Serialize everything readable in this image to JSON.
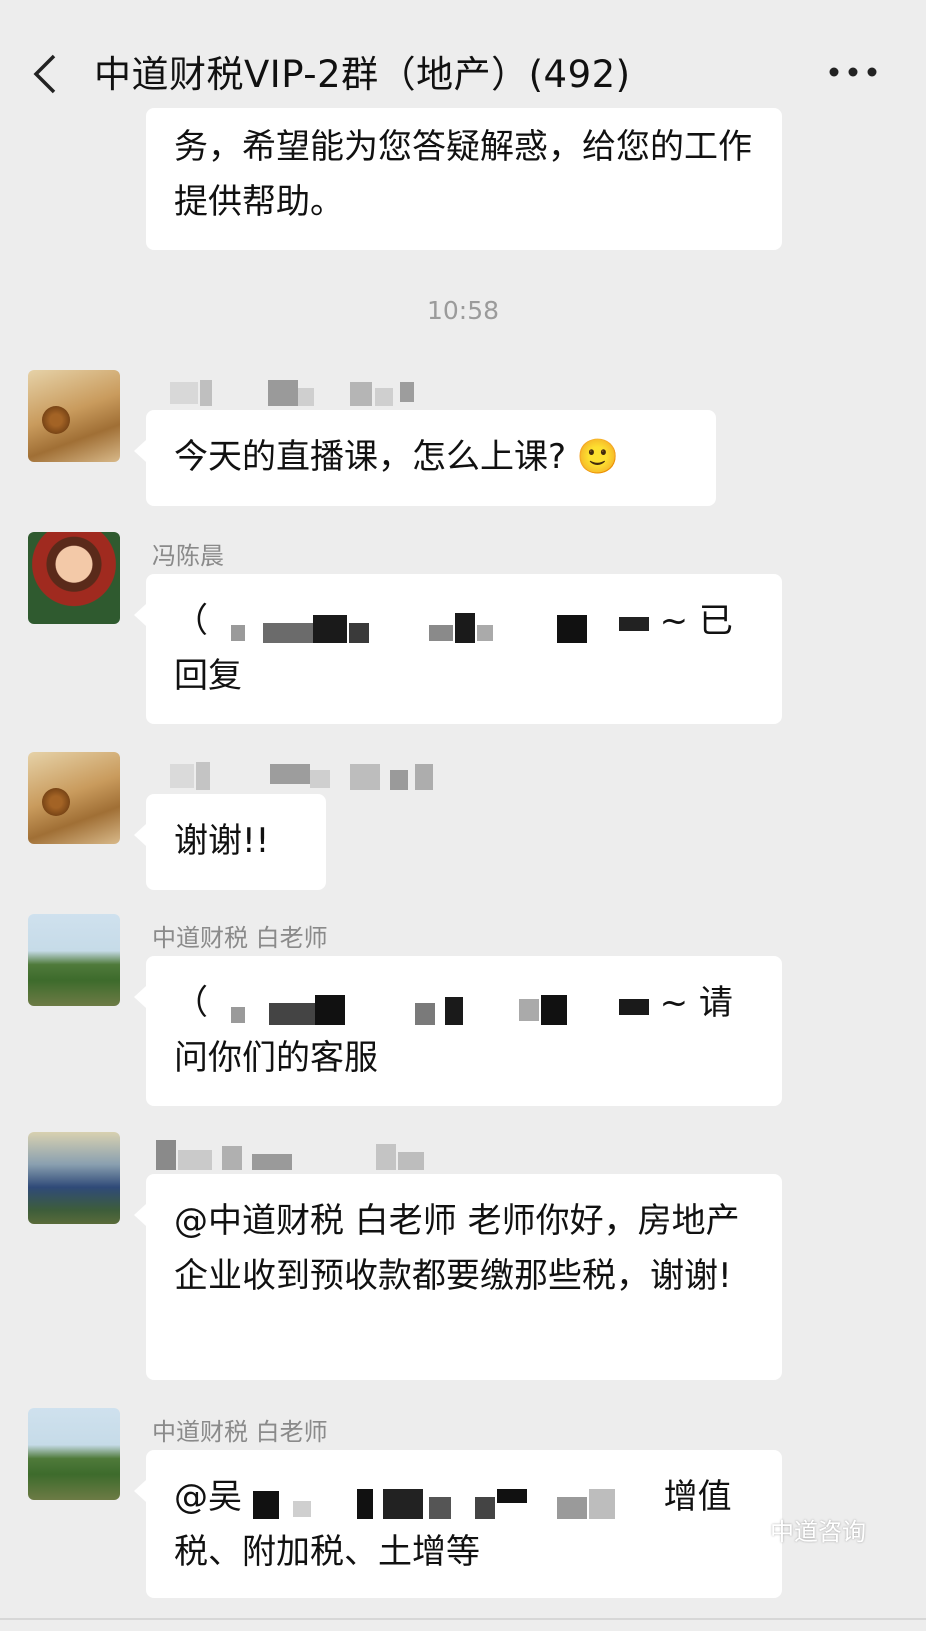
{
  "header": {
    "title": "中道财税VIP-2群（地产）(492)",
    "back_icon": "chevron-left-icon",
    "more_icon": "more-dots-icon"
  },
  "messages": [
    {
      "text": "务，希望能为您答疑解惑，给您的工作提供帮助。"
    },
    {
      "time": "10:58"
    },
    {
      "sender": "",
      "text": "今天的直播课，怎么上课? 🙂"
    },
    {
      "sender": "冯陈晨",
      "text_prefix": "（",
      "text_tail": "~  已回复"
    },
    {
      "sender": "",
      "text": "谢谢!!"
    },
    {
      "sender": "中道财税 白老师",
      "text_prefix": "（",
      "text_tail": "~  请问你们的客服"
    },
    {
      "sender": "",
      "text": "@中道财税 白老师   老师你好，房地产企业收到预收款都要缴那些税，谢谢!"
    },
    {
      "sender": "中道财税 白老师",
      "text_prefix": "@吴",
      "text_tail": "增值税、附加税、土增等"
    }
  ],
  "watermark": "中道咨询",
  "colors": {
    "background": "#ededed",
    "bubble": "#ffffff",
    "sender": "#8a8a8a"
  }
}
